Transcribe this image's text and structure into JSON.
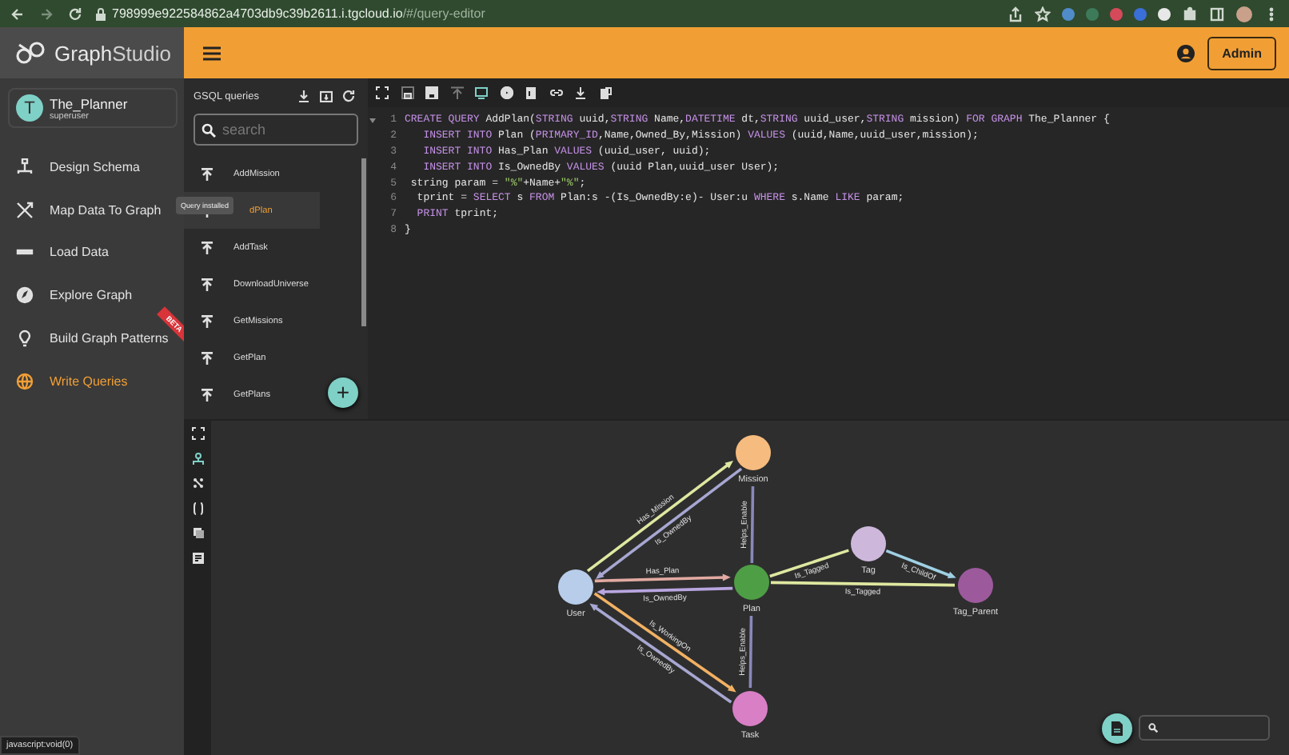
{
  "browser": {
    "url_host": "798999e922584862a4703db9c39b2611.i.tgcloud.io",
    "url_path": "/#/query-editor",
    "status_text": "javascript:void(0)"
  },
  "header": {
    "logo_bold": "Graph",
    "logo_light": "Studio",
    "user_button": "Admin"
  },
  "sidebar": {
    "user": {
      "initial": "T",
      "name": "The_Planner",
      "role": "superuser"
    },
    "items": [
      {
        "label": "Design Schema",
        "selected": false
      },
      {
        "label": "Map Data To Graph",
        "selected": false
      },
      {
        "label": "Load Data",
        "selected": false
      },
      {
        "label": "Explore Graph",
        "selected": false
      },
      {
        "label": "Build Graph Patterns",
        "selected": false,
        "badge": "BETA"
      },
      {
        "label": "Write Queries",
        "selected": true
      }
    ]
  },
  "queries_panel": {
    "title": "GSQL queries",
    "search": {
      "placeholder": "search"
    },
    "queries": [
      {
        "name": "AddMission",
        "selected": false
      },
      {
        "name": "dPlan",
        "selected": true
      },
      {
        "name": "AddTask",
        "selected": false
      },
      {
        "name": "DownloadUniverse",
        "selected": false
      },
      {
        "name": "GetMissions",
        "selected": false
      },
      {
        "name": "GetPlan",
        "selected": false
      },
      {
        "name": "GetPlans",
        "selected": false
      }
    ],
    "tooltip": "Query installed",
    "add_button": "+"
  },
  "editor": {
    "lines": [
      {
        "number": "1",
        "tokens": [
          {
            "kind": "keyword",
            "text": "CREATE QUERY"
          },
          {
            "kind": "plain",
            "text": " AddPlan("
          },
          {
            "kind": "keyword",
            "text": "STRING"
          },
          {
            "kind": "plain",
            "text": " uuid,"
          },
          {
            "kind": "keyword",
            "text": "STRING"
          },
          {
            "kind": "plain",
            "text": " Name,"
          },
          {
            "kind": "keyword",
            "text": "DATETIME"
          },
          {
            "kind": "plain",
            "text": " dt,"
          },
          {
            "kind": "keyword",
            "text": "STRING"
          },
          {
            "kind": "plain",
            "text": " uuid_user,"
          },
          {
            "kind": "keyword",
            "text": "STRING"
          },
          {
            "kind": "plain",
            "text": " mission) "
          },
          {
            "kind": "keyword",
            "text": "FOR GRAPH"
          },
          {
            "kind": "plain",
            "text": " The_Planner {"
          }
        ]
      },
      {
        "number": "2",
        "tokens": [
          {
            "kind": "keyword",
            "text": "   INSERT INTO"
          },
          {
            "kind": "plain",
            "text": " Plan ("
          },
          {
            "kind": "keyword",
            "text": "PRIMARY_ID"
          },
          {
            "kind": "plain",
            "text": ",Name,Owned_By,Mission) "
          },
          {
            "kind": "keyword",
            "text": "VALUES"
          },
          {
            "kind": "plain",
            "text": " (uuid,Name,uuid_user,mission);"
          }
        ]
      },
      {
        "number": "3",
        "tokens": [
          {
            "kind": "keyword",
            "text": "   INSERT INTO"
          },
          {
            "kind": "plain",
            "text": " Has_Plan "
          },
          {
            "kind": "keyword",
            "text": "VALUES"
          },
          {
            "kind": "plain",
            "text": " (uuid_user, uuid);"
          }
        ]
      },
      {
        "number": "4",
        "tokens": [
          {
            "kind": "keyword",
            "text": "   INSERT INTO"
          },
          {
            "kind": "plain",
            "text": " Is_OwnedBy "
          },
          {
            "kind": "keyword",
            "text": "VALUES"
          },
          {
            "kind": "plain",
            "text": " (uuid Plan,uuid_user User);"
          }
        ]
      },
      {
        "number": "5",
        "tokens": [
          {
            "kind": "plain",
            "text": " string param = "
          },
          {
            "kind": "string",
            "text": "\"%\""
          },
          {
            "kind": "plain",
            "text": "+Name+"
          },
          {
            "kind": "string",
            "text": "\"%\""
          },
          {
            "kind": "plain",
            "text": ";"
          }
        ]
      },
      {
        "number": "6",
        "tokens": [
          {
            "kind": "plain",
            "text": "  tprint = "
          },
          {
            "kind": "keyword",
            "text": "SELECT"
          },
          {
            "kind": "plain",
            "text": " s "
          },
          {
            "kind": "keyword",
            "text": "FROM"
          },
          {
            "kind": "plain",
            "text": " Plan:s -(Is_OwnedBy:e)- User:u "
          },
          {
            "kind": "keyword",
            "text": "WHERE"
          },
          {
            "kind": "plain",
            "text": " s.Name "
          },
          {
            "kind": "keyword",
            "text": "LIKE"
          },
          {
            "kind": "plain",
            "text": " param;"
          }
        ]
      },
      {
        "number": "7",
        "tokens": [
          {
            "kind": "keyword",
            "text": "  PRINT"
          },
          {
            "kind": "plain",
            "text": " tprint;"
          }
        ]
      },
      {
        "number": "8",
        "tokens": [
          {
            "kind": "plain",
            "text": "}"
          }
        ]
      }
    ]
  },
  "graph": {
    "nodes": [
      {
        "label": "User",
        "color": "#b8cdea"
      },
      {
        "label": "Mission",
        "color": "#f6bb7e"
      },
      {
        "label": "Plan",
        "color": "#4e9e45"
      },
      {
        "label": "Tag",
        "color": "#cdb8dc"
      },
      {
        "label": "Tag_Parent",
        "color": "#9c5a9c"
      },
      {
        "label": "Task",
        "color": "#d97fc6"
      }
    ],
    "edges": [
      {
        "label": "Has_Mission",
        "color": "#dfe8a0",
        "arrow_head": true
      },
      {
        "label": "Is_OwnedBy",
        "color": "#a7a7d2",
        "arrow_head": true
      },
      {
        "label": "Has_Plan",
        "color": "#e2aaa2",
        "arrow_head": true
      },
      {
        "label": "Is_OwnedBy",
        "color": "#b9a6e0",
        "arrow_head": true
      },
      {
        "label": "Is_WorkingOn",
        "color": "#f2b163",
        "arrow_head": true
      },
      {
        "label": "Is_OwnedBy",
        "color": "#a7a7d2",
        "arrow_head": true
      },
      {
        "label": "Helps_Enable",
        "color": "#8888bb",
        "arrow_head": false
      },
      {
        "label": "Helps_Enable",
        "color": "#8888bb",
        "arrow_head": false
      },
      {
        "label": "Is_Tagged",
        "color": "#dfe8a0",
        "arrow_head": false
      },
      {
        "label": "Is_ChildOf",
        "color": "#9fd0e4",
        "arrow_head": true
      },
      {
        "label": "Is_Tagged",
        "color": "#dfe8a0",
        "arrow_head": false
      }
    ]
  }
}
